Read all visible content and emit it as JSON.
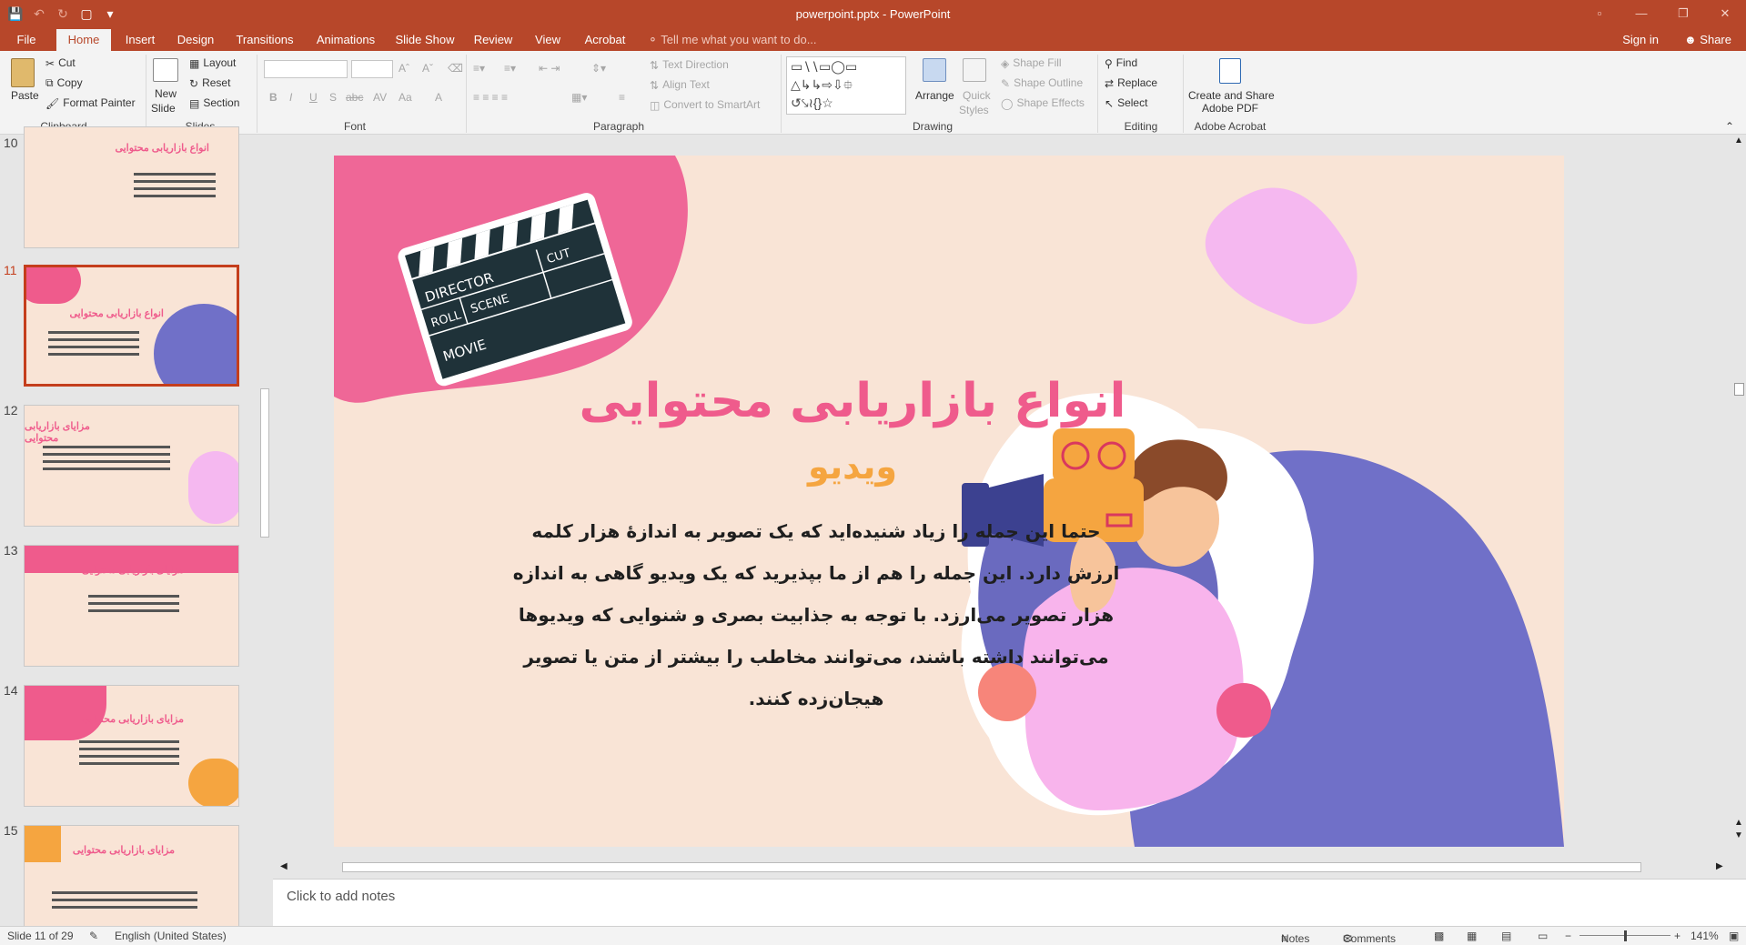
{
  "window": {
    "title": "powerpoint.pptx - PowerPoint",
    "controls": [
      "restore-icon",
      "minimize-icon",
      "maximize-icon",
      "close-icon"
    ]
  },
  "tabs": [
    {
      "label": "File"
    },
    {
      "label": "Home",
      "active": true
    },
    {
      "label": "Insert"
    },
    {
      "label": "Design"
    },
    {
      "label": "Transitions"
    },
    {
      "label": "Animations"
    },
    {
      "label": "Slide Show"
    },
    {
      "label": "Review"
    },
    {
      "label": "View"
    },
    {
      "label": "Acrobat"
    }
  ],
  "tell_me": "Tell me what you want to do...",
  "sign_in": "Sign in",
  "share": "Share",
  "ribbon": {
    "clipboard": {
      "paste": "Paste",
      "cut": "Cut",
      "copy": "Copy",
      "format_painter": "Format Painter",
      "label": "Clipboard"
    },
    "slides": {
      "new_slide_1": "New",
      "new_slide_2": "Slide",
      "layout": "Layout",
      "reset": "Reset",
      "section": "Section",
      "label": "Slides"
    },
    "font": {
      "label": "Font",
      "bold": "B",
      "italic": "I",
      "underline": "U",
      "shadow": "S",
      "strike": "abc",
      "spacing": "AV",
      "case": "Aa",
      "color": "A"
    },
    "paragraph": {
      "label": "Paragraph",
      "text_direction": "Text Direction",
      "align_text": "Align Text",
      "convert_smartart": "Convert to SmartArt"
    },
    "drawing": {
      "label": "Drawing",
      "arrange": "Arrange",
      "quick_styles_1": "Quick",
      "quick_styles_2": "Styles",
      "shape_fill": "Shape Fill",
      "shape_outline": "Shape Outline",
      "shape_effects": "Shape Effects"
    },
    "editing": {
      "label": "Editing",
      "find": "Find",
      "replace": "Replace",
      "select": "Select"
    },
    "acrobat": {
      "label": "Adobe Acrobat",
      "create_1": "Create and Share",
      "create_2": "Adobe PDF"
    }
  },
  "thumbnails": [
    {
      "num": "10",
      "title": "انواع بازاریابی محتوایی"
    },
    {
      "num": "11",
      "title": "انواع بازاریابی محتوایی",
      "selected": true
    },
    {
      "num": "12",
      "title": "مزایای بازاریابی محتوایی"
    },
    {
      "num": "13",
      "title": "مزایای بازاریابی محتوایی"
    },
    {
      "num": "14",
      "title": "مزایای بازاریابی محتوایی"
    },
    {
      "num": "15",
      "title": "مزایای بازاریابی محتوایی"
    }
  ],
  "slide": {
    "title": "انواع بازاریابی محتوایی",
    "subtitle": "ویدیو",
    "body": "حتما این جمله را زیاد شنیده‌اید که یک تصویر به اندازهٔ هزار کلمه ارزش دارد. این جمله را هم از ما بپذیرید که یک ویدیو گاهی به اندازه هزار تصویر می‌ارزد. با توجه به جذابیت بصری و شنوایی که ویدیوها می‌توانند داشته باشند، می‌توانند مخاطب را بیشتر از متن یا تصویر هیجان‌زده کنند.",
    "clapper": {
      "director": "DIRECTOR",
      "cut": "CUT",
      "roll": "ROLL",
      "scene": "SCENE",
      "movie": "MOVIE"
    },
    "colors": {
      "background": "#f9e4d6",
      "pink": "#ef5b8c",
      "orange": "#f5a540",
      "purple": "#7070c8",
      "lilac": "#f5b8f0"
    }
  },
  "notes_placeholder": "Click to add notes",
  "status": {
    "slide_info": "Slide 11 of 29",
    "language": "English (United States)",
    "notes": "Notes",
    "comments": "Comments",
    "zoom": "141%"
  }
}
